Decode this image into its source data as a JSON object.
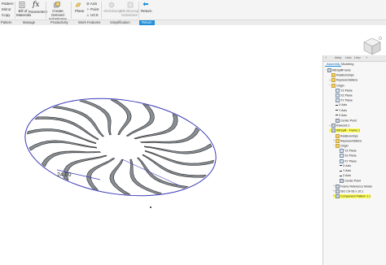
{
  "ribbon": {
    "pattern_group": {
      "btn1": "Pattern",
      "btn2": "Mirror",
      "btn3": "Copy"
    },
    "bom_label": "Bill of Materials",
    "parameters_label": "Parameters",
    "derived_label": "Create Derived Substitutes",
    "plane_label": "Plane",
    "axis_label": "Axis",
    "point_label": "Point",
    "ucs_label": "UCS",
    "shrinkwrap_label": "Shrinkwrap",
    "shrinkwrap_sub_label": "Shrinkwrap Substitute",
    "return_label": "Return",
    "groups": {
      "pattern": "Pattern",
      "manage": "Manage",
      "productivity": "Productivity",
      "work_features": "Work Features",
      "simplification": "Simplification",
      "return": "Return"
    }
  },
  "viewport": {
    "dimension_label": "24.00"
  },
  "browser": {
    "tabs": [
      "+",
      "Assy",
      "Lerp",
      "Lerp",
      "+"
    ],
    "subtabs": {
      "assembly": "Assembly",
      "modeling": "Modeling"
    },
    "tree": [
      {
        "label": "RibSplitFrame",
        "indent": 0,
        "icon": "part",
        "exp": "−"
      },
      {
        "label": "Relationships",
        "indent": 1,
        "icon": "folder",
        "exp": ""
      },
      {
        "label": "Representations",
        "indent": 1,
        "icon": "folder",
        "exp": "+"
      },
      {
        "label": "Origin",
        "indent": 1,
        "icon": "folder",
        "exp": "−"
      },
      {
        "label": "YZ Plane",
        "indent": 2,
        "icon": "plane",
        "exp": ""
      },
      {
        "label": "XZ Plane",
        "indent": 2,
        "icon": "plane",
        "exp": ""
      },
      {
        "label": "XY Plane",
        "indent": 2,
        "icon": "plane",
        "exp": ""
      },
      {
        "label": "X Axis",
        "indent": 2,
        "icon": "axis",
        "exp": ""
      },
      {
        "label": "Y Axis",
        "indent": 2,
        "icon": "axis",
        "exp": ""
      },
      {
        "label": "Z Axis",
        "indent": 2,
        "icon": "axis",
        "exp": ""
      },
      {
        "label": "Center Point",
        "indent": 2,
        "icon": "part",
        "exp": ""
      },
      {
        "label": "Rawcels:1",
        "indent": 1,
        "icon": "part",
        "exp": "+"
      },
      {
        "label": "RibSplit - Frame:1",
        "indent": 1,
        "icon": "part",
        "exp": "−",
        "hl": true
      },
      {
        "label": "Relationships",
        "indent": 2,
        "icon": "folder",
        "exp": ""
      },
      {
        "label": "Representations",
        "indent": 2,
        "icon": "folder",
        "exp": "+"
      },
      {
        "label": "Origin",
        "indent": 2,
        "icon": "folder",
        "exp": "−"
      },
      {
        "label": "YZ Plane",
        "indent": 3,
        "icon": "plane",
        "exp": ""
      },
      {
        "label": "XZ Plane",
        "indent": 3,
        "icon": "plane",
        "exp": ""
      },
      {
        "label": "XY Plane",
        "indent": 3,
        "icon": "plane",
        "exp": ""
      },
      {
        "label": "X Axis",
        "indent": 3,
        "icon": "axis",
        "exp": ""
      },
      {
        "label": "Y Axis",
        "indent": 3,
        "icon": "axis",
        "exp": ""
      },
      {
        "label": "Z Axis",
        "indent": 3,
        "icon": "axis",
        "exp": ""
      },
      {
        "label": "Center Point",
        "indent": 3,
        "icon": "part",
        "exp": ""
      },
      {
        "label": "Frame Reference Model",
        "indent": 2,
        "icon": "part",
        "exp": "+"
      },
      {
        "label": "ISO CH 06 x 10:1",
        "indent": 2,
        "icon": "part",
        "exp": "+"
      },
      {
        "label": "Component Pattern 1:1",
        "indent": 2,
        "icon": "part",
        "exp": "+",
        "hl": true
      }
    ]
  },
  "colors": {
    "accent": "#1e8fd8",
    "highlight": "#ffff5a",
    "circle": "#3a3ab8"
  }
}
